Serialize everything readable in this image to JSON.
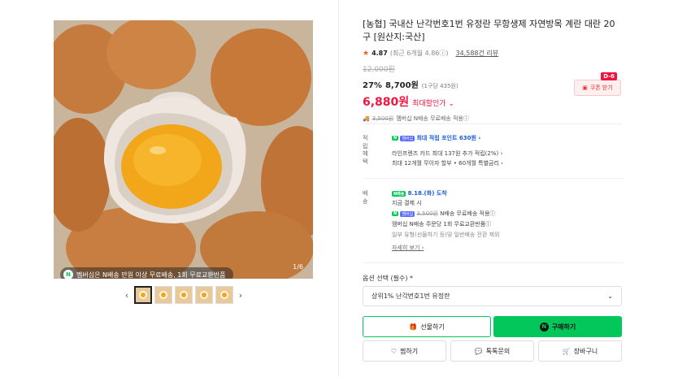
{
  "gallery": {
    "banner_text": "멤버십은 N배송 만원 이상 무료배송, 1회 무료교환반품",
    "counter": "1/6",
    "thumbnail_count": 5,
    "prev_glyph": "‹",
    "next_glyph": "›"
  },
  "product": {
    "title": "[농협] 국내산 난각번호1번 유정란 무항생제 자연방목 계란 대란 20구 [원산지:국산]",
    "rating": "4.87",
    "rating_sub": "(최근 6개월 4.86ⓘ)",
    "review_count": "34,588건 리뷰",
    "original_price": "12,000원",
    "discount_pct": "27%",
    "sale_price": "8,700원",
    "unit_price": "(1구당 435원)",
    "max_price": "6,880원",
    "max_label": "최대할인가 ⌄",
    "shipping_strike": "3,500원",
    "shipping_note": "멤버십 N배송 무료배송 적용ⓘ",
    "coupon_label": "쿠폰 받기",
    "coupon_badge": "D-6"
  },
  "info": {
    "points_label": "적립",
    "points_badge_n": "N",
    "points_badge_m": "멤버십",
    "points_value": "최대 적립 포인트 630원 ›",
    "benefit_label": "혜택",
    "benefit_line1": "라인프렌즈 카드 최대 137원 추가 적립(2%) ›",
    "benefit_line2": "최대 12개월 무이자 할부 • 60개월 특별금리 ›",
    "delivery_label": "배송",
    "delivery_badge": "N배송",
    "delivery_date": "8.18.(화) 도착",
    "delivery_line2": "지금 결제 시",
    "delivery_strike": "3,500원",
    "delivery_line3": "N배송 무료배송 적용ⓘ",
    "delivery_line4": "멤버십 N배송 주문당 1회 무료교환반품ⓘ",
    "delivery_line5": "일부 유형(선물하기 등)및 일반배송 전환 제외",
    "delivery_more": "자세히 보기 ›"
  },
  "options": {
    "label": "옵션 선택 (필수) *",
    "selected": "상위1% 난각번호1번 유정란",
    "chevron": "⌄"
  },
  "actions": {
    "gift": "선물하기",
    "buy": "구매하기",
    "wish": "찜하기",
    "talk": "톡톡문의",
    "cart": "장바구니"
  },
  "colors": {
    "accent_green": "#03c75a",
    "price_red": "#f0153f",
    "points_blue": "#1a5cdb"
  }
}
